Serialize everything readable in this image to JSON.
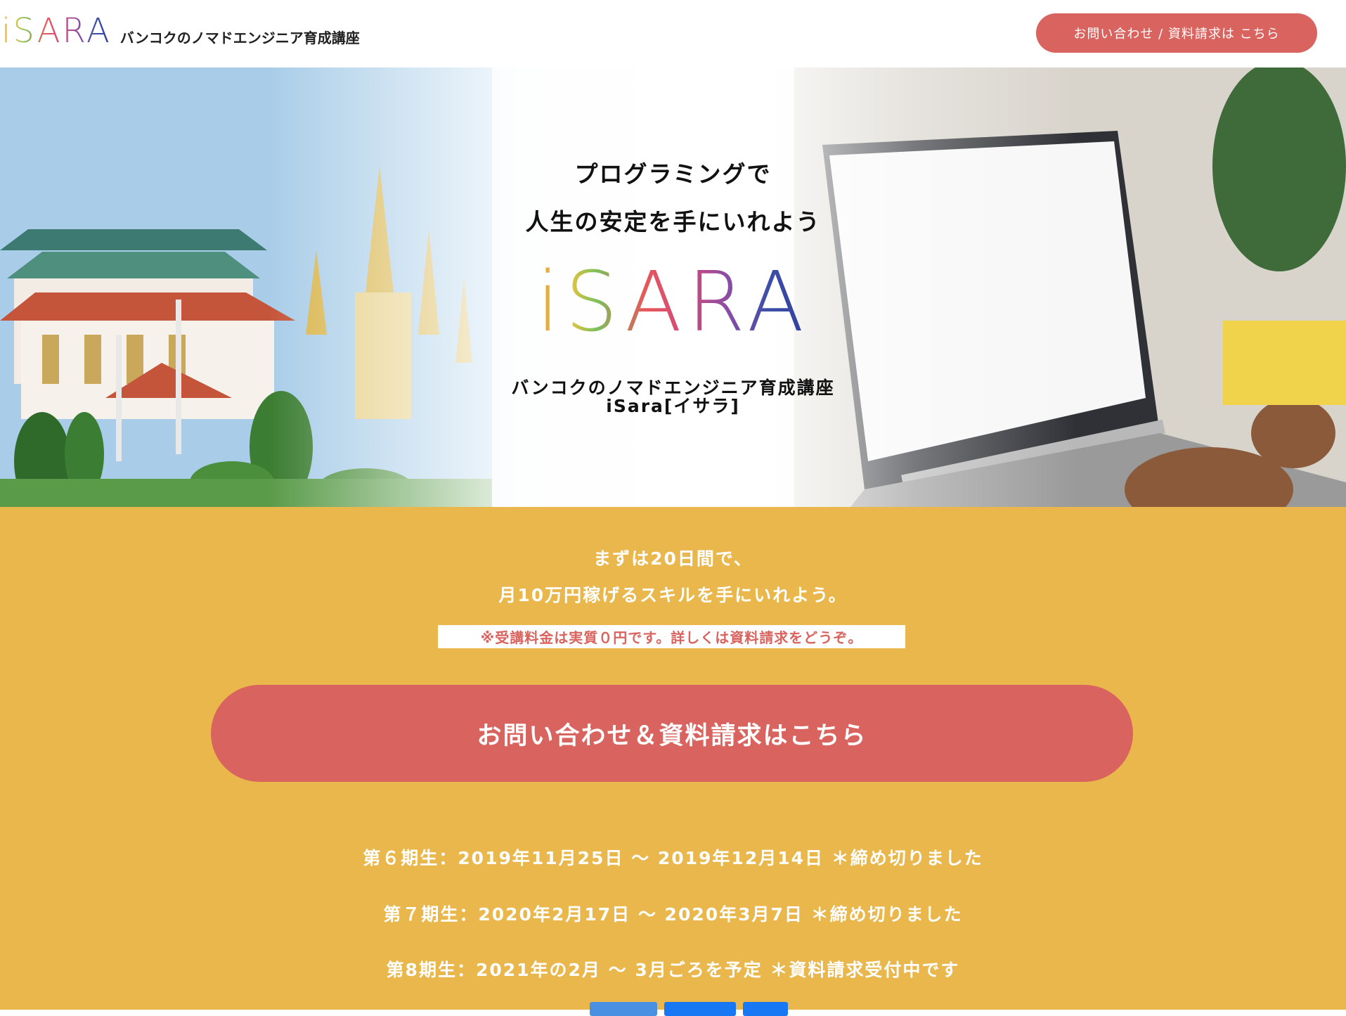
{
  "header": {
    "logo": "iSARA",
    "tagline": "バンコクのノマドエンジニア育成講座",
    "cta_label": "お問い合わせ / 資料請求は こちら"
  },
  "hero": {
    "line1": "プログラミングで",
    "line2": "人生の安定を手にいれよう",
    "logo": "iSARA",
    "sub1": "バンコクのノマドエンジニア育成講座",
    "sub2": "iSara[イサラ]"
  },
  "offer": {
    "line1": "まずは20日間で、",
    "line2": "月10万円稼げるスキルを手にいれよう。",
    "note": "※受講料金は実質０円です。詳しくは資料請求をどうぞ。",
    "cta_label": "お問い合わせ＆資料請求はこちら"
  },
  "terms": [
    "第６期生：2019年11月25日 ～ 2019年12月14日 ＊締め切りました",
    "第７期生：2020年2月17日 ～ 2020年3月7日 ＊締め切りました",
    "第8期生：2021年の2月 ～ 3月ごろを予定 ＊資料請求受付中です"
  ],
  "colors": {
    "accent": "#d9645f",
    "yellow_bg": "#e9b74b",
    "white": "#ffffff"
  }
}
